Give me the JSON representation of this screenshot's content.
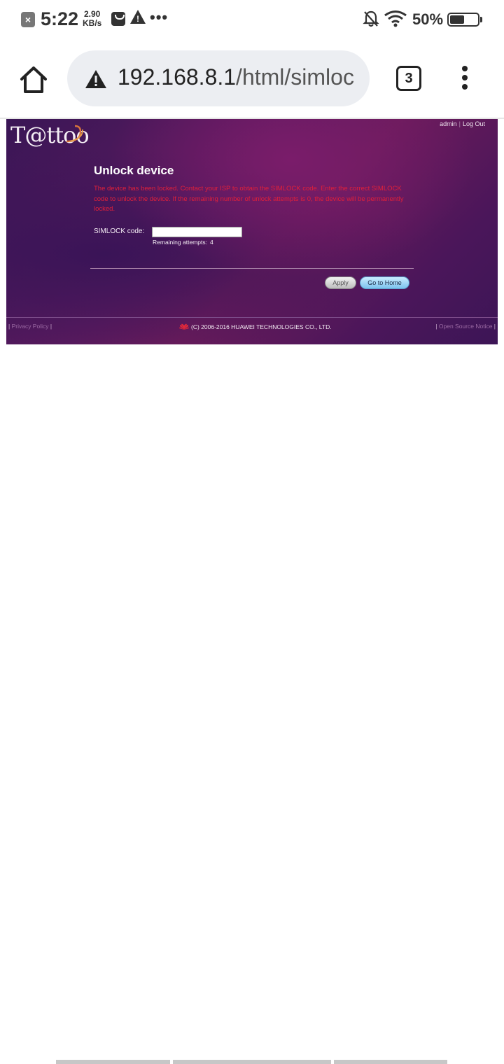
{
  "status_bar": {
    "time": "5:22",
    "speed_value": "2.90",
    "speed_unit": "KB/s",
    "battery_percent": "50%",
    "tabs_count": "3"
  },
  "browser": {
    "url_host": "192.168.8.1",
    "url_path": "/html/simloc"
  },
  "router_page": {
    "logo": "T@ttoo",
    "top_links": {
      "user": "admin",
      "logout": "Log Out"
    },
    "title": "Unlock device",
    "warning": "The device has been locked. Contact your ISP to obtain the SIMLOCK code. Enter the correct SIMLOCK code to unlock the device. If the remaining number of unlock attempts is 0, the device will be permanently locked.",
    "code_label": "SIMLOCK code:",
    "code_value": "",
    "remaining_label": "Remaining attempts:",
    "remaining_value": "4",
    "apply_label": "Apply",
    "go_home_label": "Go to Home",
    "footer": {
      "privacy": "Privacy Policy",
      "copyright": "(C) 2006-2016 HUAWEI TECHNOLOGIES CO., LTD.",
      "open_source": "Open Source Notice"
    }
  },
  "colors": {
    "warning_text": "#e0203a",
    "router_bg": "#5a1a5e",
    "go_home_button": "#7cc3ee"
  }
}
